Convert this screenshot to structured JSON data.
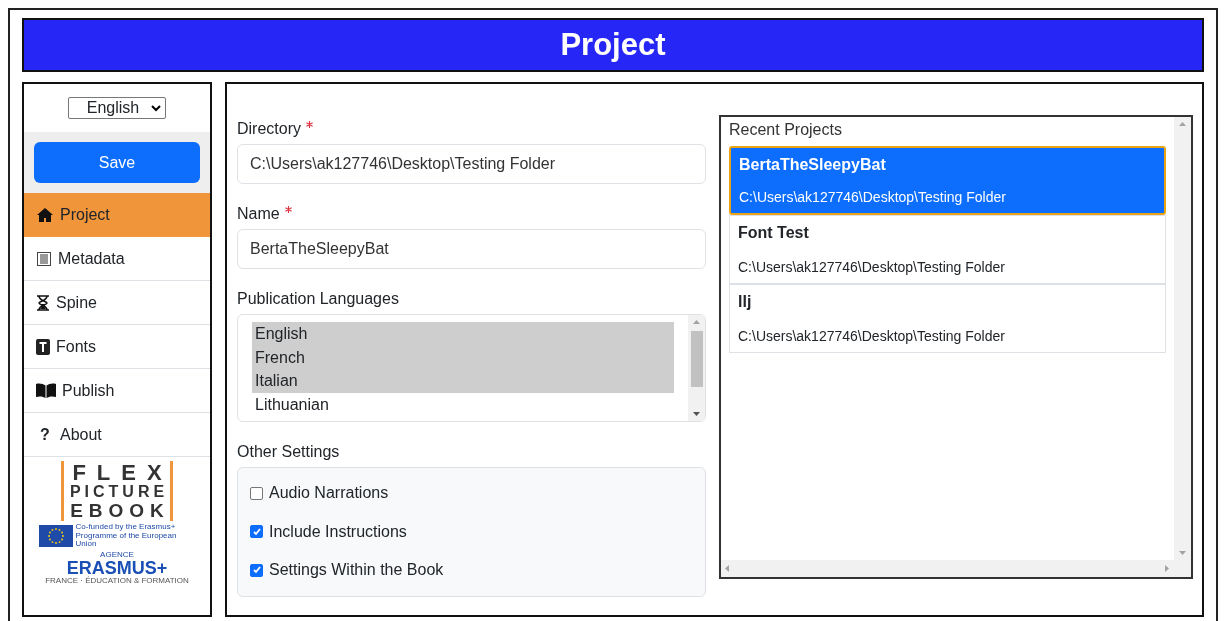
{
  "header": {
    "title": "Project"
  },
  "sidebar": {
    "language": "English",
    "save_button": "Save",
    "items": [
      {
        "label": "Project",
        "selected": true
      },
      {
        "label": "Metadata",
        "selected": false
      },
      {
        "label": "Spine",
        "selected": false
      },
      {
        "label": "Fonts",
        "selected": false
      },
      {
        "label": "Publish",
        "selected": false
      },
      {
        "label": "About",
        "selected": false,
        "icon_text": "?"
      }
    ],
    "logo": {
      "lines": [
        "FLEX",
        "PICTURE",
        "EBOOK"
      ]
    },
    "eu_text": "Co-funded by the Erasmus+ Programme of the European Union",
    "erasmus": {
      "agency": "AGENCE",
      "name": "ERASMUS+",
      "sub": "FRANCE · ÉDUCATION & FORMATION"
    }
  },
  "form": {
    "directory": {
      "label": "Directory",
      "required": true,
      "value": "C:\\Users\\ak127746\\Desktop\\Testing Folder"
    },
    "name": {
      "label": "Name",
      "required": true,
      "value": "BertaTheSleepyBat"
    },
    "languages": {
      "label": "Publication Languages",
      "options": [
        {
          "label": "English",
          "selected": true
        },
        {
          "label": "French",
          "selected": true
        },
        {
          "label": "Italian",
          "selected": true
        },
        {
          "label": "Lithuanian",
          "selected": false
        }
      ]
    },
    "other_settings": {
      "label": "Other Settings",
      "options": [
        {
          "label": "Audio Narrations",
          "checked": false
        },
        {
          "label": "Include Instructions",
          "checked": true
        },
        {
          "label": "Settings Within the Book",
          "checked": true
        }
      ]
    }
  },
  "recent": {
    "title": "Recent Projects",
    "items": [
      {
        "name": "BertaTheSleepyBat",
        "path": "C:\\Users\\ak127746\\Desktop\\Testing Folder",
        "selected": true
      },
      {
        "name": "Font Test",
        "path": "C:\\Users\\ak127746\\Desktop\\Testing Folder",
        "selected": false
      },
      {
        "name": "llj",
        "path": "C:\\Users\\ak127746\\Desktop\\Testing Folder",
        "selected": false
      }
    ]
  }
}
